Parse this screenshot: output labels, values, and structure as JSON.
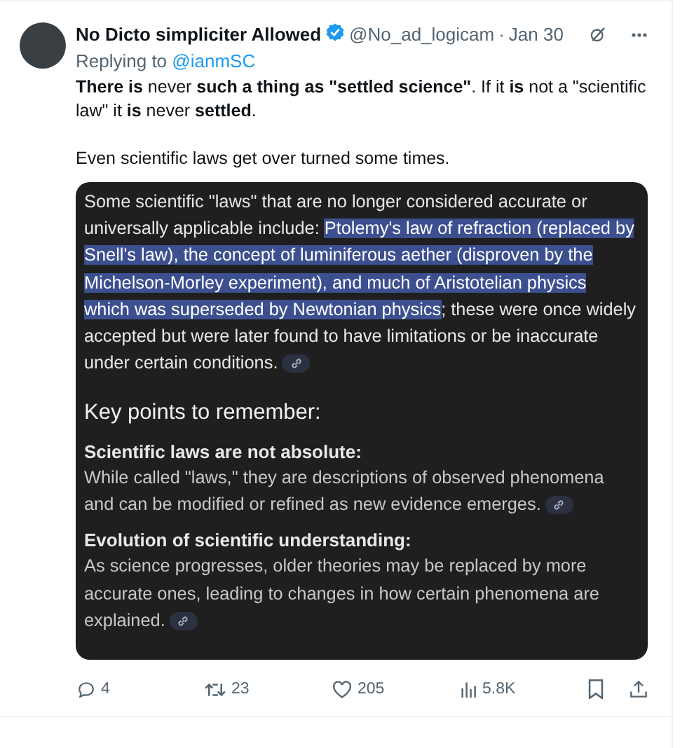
{
  "tweet": {
    "author_name": "No Dicto simpliciter Allowed",
    "verified": true,
    "handle": "@No_ad_logicam",
    "separator": "·",
    "date": "Jan 30",
    "replying_label": "Replying to",
    "replying_to": "@ianmSC",
    "paragraphs": [
      "**There is** never **such a thing as \"settled science\"**. If it **is** not a \"scientific law\" it **is** never **settled**.",
      "Even scientific laws get over turned some times."
    ],
    "embedded_answer": {
      "intro": [
        {
          "text": "Some scientific \"laws\" that are no longer considered accurate or universally applicable include: ",
          "highlighted": false
        },
        {
          "text": "Ptolemy's law of refraction (replaced by Snell's law), the concept of luminiferous aether (disproven by the Michelson-Morley experiment), and much of Aristotelian physics which was superseded by Newtonian physics",
          "highlighted": true
        },
        {
          "text": "; these were once widely accepted but were later found to have limitations or be inaccurate under certain conditions.",
          "highlighted": false
        }
      ],
      "heading": "Key points to remember:",
      "points": [
        {
          "title": "Scientific laws are not absolute:",
          "body": "While called \"laws,\" they are descriptions of observed phenomena and can be modified or refined as new evidence emerges."
        },
        {
          "title": "Evolution of scientific understanding:",
          "body": "As science progresses, older theories may be replaced by more accurate ones, leading to changes in how certain phenomena are explained."
        }
      ]
    },
    "actions": [
      {
        "kind": "reply",
        "count": "4"
      },
      {
        "kind": "repost",
        "count": "23"
      },
      {
        "kind": "like",
        "count": "205"
      },
      {
        "kind": "views",
        "count": "5.8K"
      },
      {
        "kind": "bookmark"
      },
      {
        "kind": "share"
      }
    ]
  }
}
